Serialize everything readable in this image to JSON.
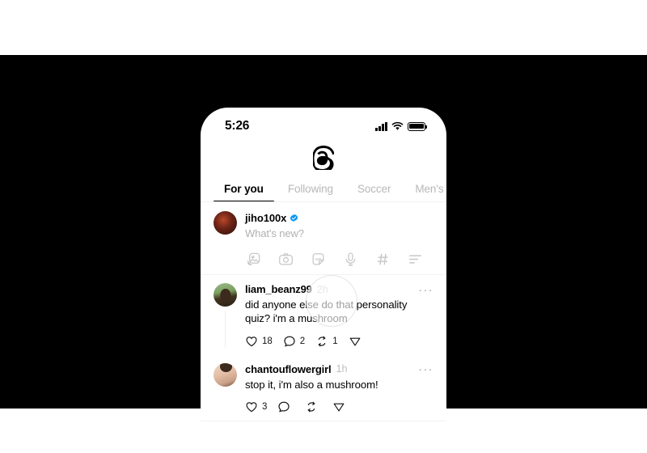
{
  "status_bar": {
    "time": "5:26",
    "icons": [
      "cellular-signal-icon",
      "wifi-icon",
      "battery-icon"
    ]
  },
  "app": {
    "name": "Threads",
    "logo_icon": "threads-logo-icon"
  },
  "tabs": [
    {
      "label": "For you",
      "active": true
    },
    {
      "label": "Following",
      "active": false
    },
    {
      "label": "Soccer",
      "active": false
    },
    {
      "label": "Men's Fas",
      "active": false
    }
  ],
  "composer": {
    "username": "jiho100x",
    "verified": true,
    "verified_icon": "verified-badge-icon",
    "placeholder": "What's new?",
    "avatar_name": "jiho100x-avatar",
    "actions": [
      {
        "name": "photo-icon"
      },
      {
        "name": "camera-icon"
      },
      {
        "name": "gif-icon"
      },
      {
        "name": "microphone-icon"
      },
      {
        "name": "hashtag-icon"
      },
      {
        "name": "poll-icon"
      }
    ]
  },
  "posts": [
    {
      "username": "liam_beanz99",
      "timestamp": "2h",
      "text": "did anyone else do that personality quiz? i'm a mushroom",
      "more_label": "···",
      "avatar_name": "liam-beanz99-avatar",
      "actions": [
        {
          "name": "like-icon",
          "count": "18"
        },
        {
          "name": "reply-icon",
          "count": "2"
        },
        {
          "name": "repost-icon",
          "count": "1"
        },
        {
          "name": "share-icon",
          "count": ""
        }
      ]
    },
    {
      "username": "chantouflowergirl",
      "timestamp": "1h",
      "text": "stop it, i'm also a mushroom!",
      "more_label": "···",
      "avatar_name": "chantouflowergirl-avatar",
      "actions": [
        {
          "name": "like-icon",
          "count": "3"
        },
        {
          "name": "reply-icon",
          "count": ""
        },
        {
          "name": "repost-icon",
          "count": ""
        },
        {
          "name": "share-icon",
          "count": ""
        }
      ]
    }
  ],
  "cursor": {
    "name": "touch-cursor-ring"
  },
  "colors": {
    "background": "#000000",
    "screen": "#ffffff",
    "text": "#000000",
    "muted": "#b8b8b8",
    "verified_blue": "#0095f6"
  }
}
